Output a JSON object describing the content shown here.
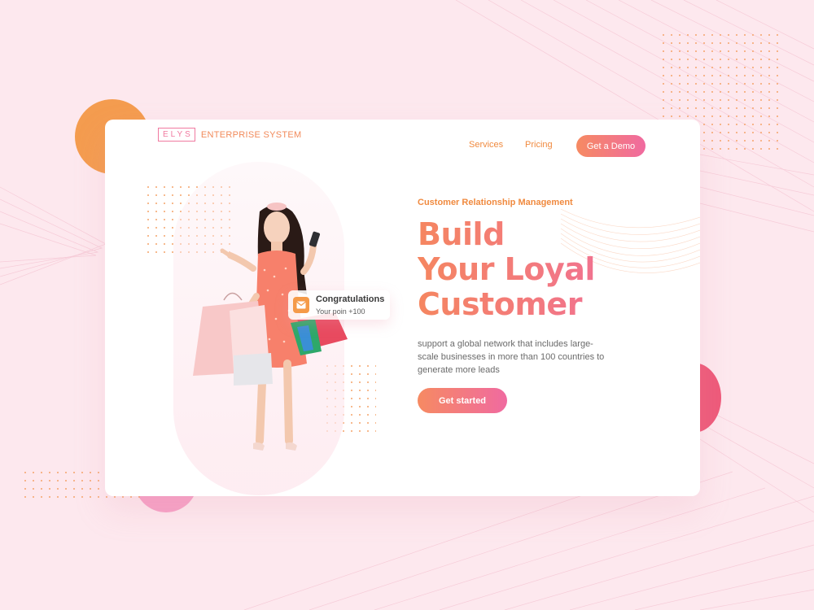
{
  "colors": {
    "page_background": "#fde8ee",
    "accent_orange": "#f08a3f",
    "accent_pink": "#f06aa0",
    "circle_orange": "#f49c4f",
    "circle_red": "#ee5a7a",
    "circle_pink": "#f6a1c6"
  },
  "brand": {
    "mark": "ELYS",
    "name": "ENTERPRISE SYSTEM"
  },
  "nav": {
    "services": "Services",
    "pricing": "Pricing",
    "demo_button": "Get a Demo"
  },
  "notification": {
    "icon": "mail-icon",
    "title": "Congratulations",
    "subtitle": "Your poin +100"
  },
  "hero": {
    "kicker": "Customer Relationship Management",
    "headline": [
      "Build",
      "Your Loyal",
      "Customer"
    ],
    "description": "support a global network that includes large-scale businesses in more than 100 countries to generate more leads",
    "cta": "Get started"
  }
}
